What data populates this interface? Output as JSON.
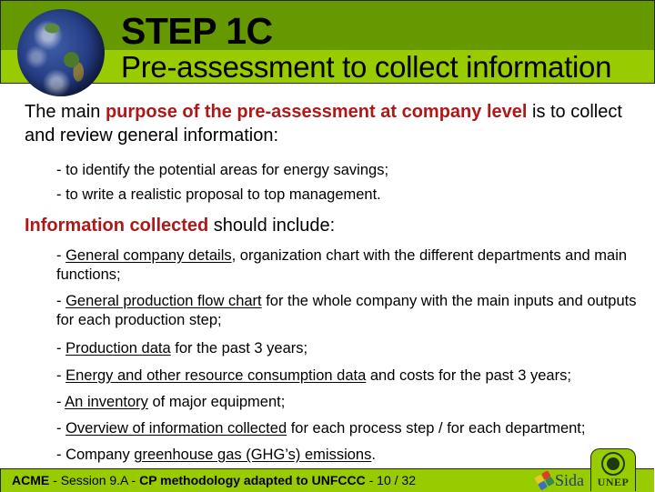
{
  "header": {
    "title": "STEP 1C",
    "subtitle": "Pre-assessment to collect information",
    "colors": {
      "dark_band": "#669900",
      "light_band": "#99cc00"
    }
  },
  "intro": {
    "lead": "The main ",
    "highlight": "purpose of the pre-assessment at company level",
    "tail": " is to collect and review general information:",
    "bullets": [
      "- to identify the potential areas for energy savings;",
      "- to write a realistic proposal to top management."
    ]
  },
  "info_section": {
    "highlight": "Information collected",
    "tail": " should include:",
    "items": [
      {
        "prefix": "- ",
        "underlined": "General company details",
        "rest": ", organization chart with the different departments and main functions;"
      },
      {
        "prefix": "- ",
        "underlined": "General production flow chart",
        "rest": " for the whole company with the main inputs and outputs for each production step;"
      },
      {
        "prefix": "- ",
        "underlined": "Production data",
        "rest": " for the past 3 years;"
      },
      {
        "prefix": "- ",
        "underlined": "Energy and other resource consumption data",
        "rest": " and costs for the past 3 years;"
      },
      {
        "prefix": "- ",
        "underlined": "An inventory",
        "rest": " of major equipment;"
      },
      {
        "prefix": "- ",
        "underlined": "Overview of information collected",
        "rest": " for each process step / for each department;"
      },
      {
        "prefix": "- Company ",
        "underlined": "greenhouse gas (GHG’s) emissions",
        "rest": "."
      }
    ]
  },
  "footer": {
    "org": "ACME",
    "sep1": " - ",
    "session": "Session 9.A",
    "sep2": " - ",
    "course": "CP methodology adapted to UNFCCC",
    "sep3": " - ",
    "page": "10 / 32",
    "sponsor_label": "Sida",
    "unep_label": "UNEP"
  },
  "accent_color": "#b01818"
}
